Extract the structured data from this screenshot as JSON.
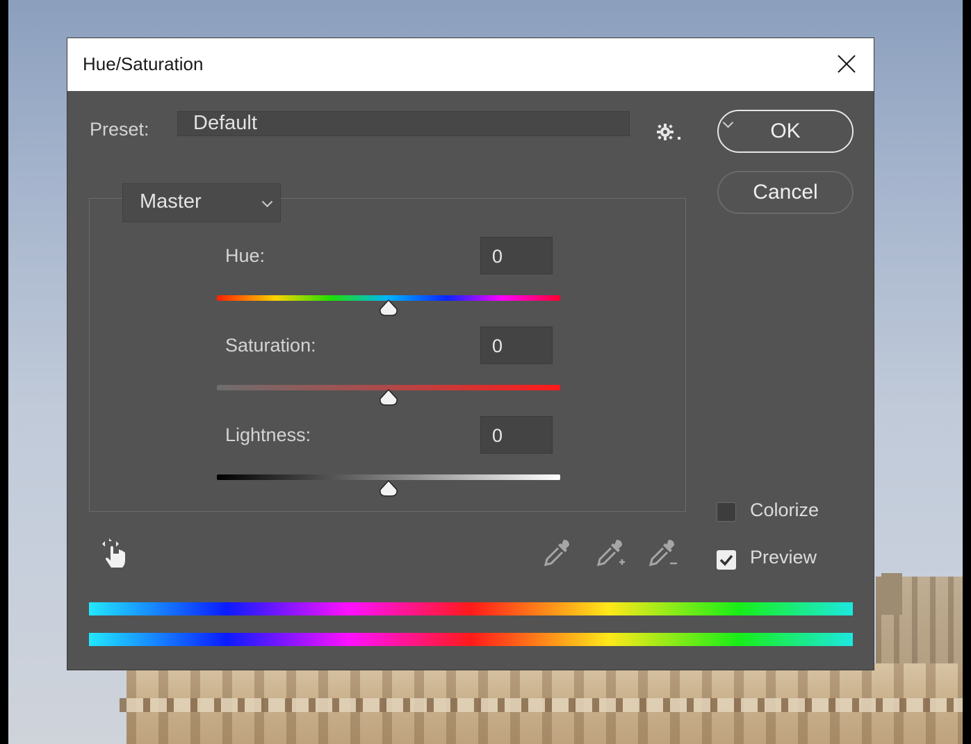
{
  "dialog": {
    "title": "Hue/Saturation",
    "preset_label": "Preset:",
    "preset_value": "Default",
    "ok_label": "OK",
    "cancel_label": "Cancel",
    "channel_value": "Master"
  },
  "adjustments": {
    "hue": {
      "label": "Hue:",
      "value": "0",
      "position": 0.5
    },
    "saturation": {
      "label": "Saturation:",
      "value": "0",
      "position": 0.5
    },
    "lightness": {
      "label": "Lightness:",
      "value": "0",
      "position": 0.5
    }
  },
  "options": {
    "colorize_label": "Colorize",
    "colorize_checked": false,
    "preview_label": "Preview",
    "preview_checked": true
  },
  "icons": {
    "gear": "gear-icon",
    "close": "close-icon",
    "targeted_adjustment": "hand-target-icon",
    "eyedropper": "eyedropper-icon",
    "eyedropper_add": "eyedropper-plus-icon",
    "eyedropper_subtract": "eyedropper-minus-icon"
  },
  "colors": {
    "dialog_bg": "#535353",
    "title_bar": "#ffffff",
    "text": "#d4d4d4"
  }
}
